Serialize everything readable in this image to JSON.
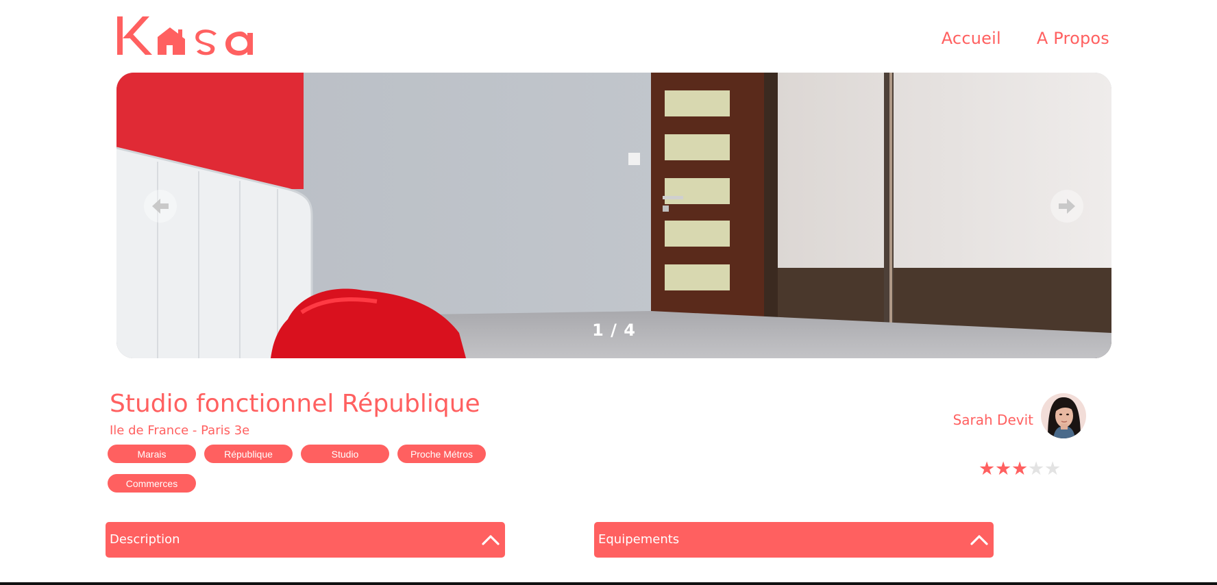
{
  "brand": {
    "logo_text": "Kasa",
    "accent_color": "#FF6060"
  },
  "nav": {
    "home_label": "Accueil",
    "about_label": "A Propos"
  },
  "gallery": {
    "current": 1,
    "total": 4,
    "counter_text": "1 / 4",
    "prev_icon": "arrow-left-icon",
    "next_icon": "arrow-right-icon"
  },
  "listing": {
    "title": "Studio fonctionnel République",
    "location": "Ile de France - Paris 3e",
    "tags": [
      "Marais",
      "République",
      "Studio",
      "Proche Métros",
      "Commerces"
    ]
  },
  "host": {
    "name": "Sarah Devit",
    "rating": 3,
    "rating_max": 5,
    "star_on_color": "#FF6060",
    "star_off_color": "#E3E3E3"
  },
  "sections": {
    "description_label": "Description",
    "equipment_label": "Equipements",
    "toggle_icon": "chevron-up-icon"
  }
}
